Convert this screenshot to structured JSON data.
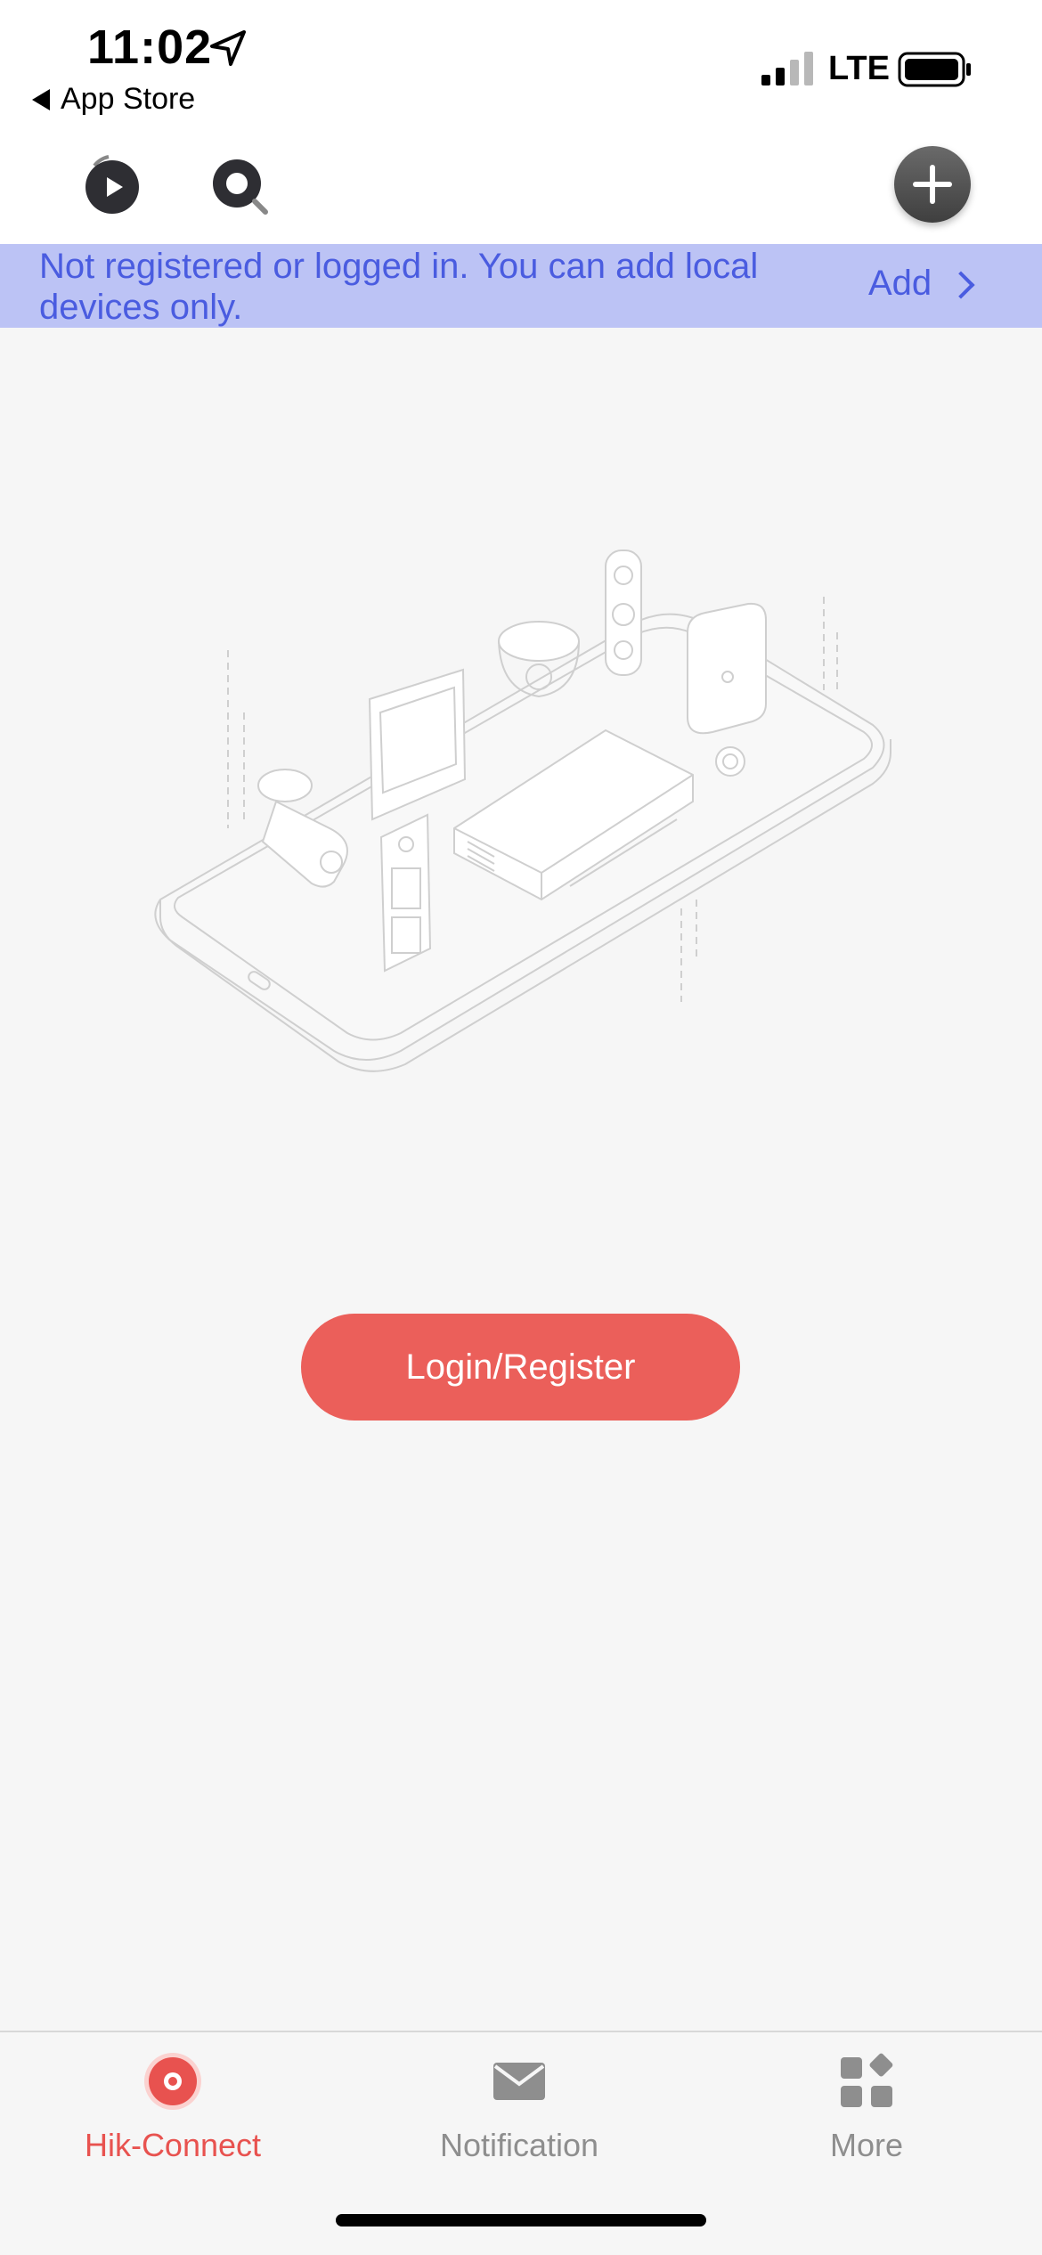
{
  "status_bar": {
    "time": "11:02",
    "back_label": "App Store",
    "network": "LTE",
    "location_icon": "location-arrow-icon",
    "signal_icon": "cellular-signal-icon",
    "battery_icon": "battery-icon"
  },
  "toolbar": {
    "playback_icon": "playback-icon",
    "search_icon": "search-icon",
    "add_icon": "plus-icon"
  },
  "banner": {
    "message": "Not registered or logged in. You can add local devices only.",
    "action_label": "Add"
  },
  "main": {
    "illustration": "devices-on-phone-illustration",
    "login_label": "Login/Register"
  },
  "tab_bar": {
    "tabs": [
      {
        "label": "Hik-Connect",
        "icon": "hik-connect-icon",
        "active": true
      },
      {
        "label": "Notification",
        "icon": "envelope-icon",
        "active": false
      },
      {
        "label": "More",
        "icon": "grid-icon",
        "active": false
      }
    ]
  },
  "colors": {
    "accent": "#eb5f5a",
    "banner_bg": "#bcc3f5",
    "banner_text": "#4a5ce0",
    "active_tab": "#e8524f",
    "inactive_tab": "#8e8e8e"
  }
}
